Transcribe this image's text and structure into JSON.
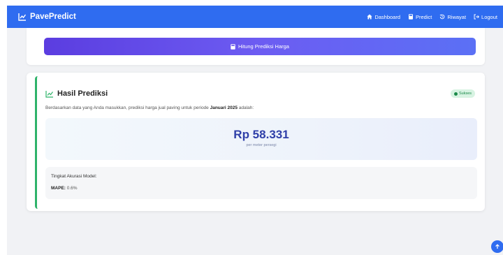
{
  "navbar": {
    "brand": "PavePredict",
    "items": [
      {
        "label": "Dashboard",
        "icon": "home-icon"
      },
      {
        "label": "Predict",
        "icon": "calculator-icon"
      },
      {
        "label": "Riwayat",
        "icon": "history-icon"
      },
      {
        "label": "Logout",
        "icon": "logout-icon"
      }
    ]
  },
  "form": {
    "calc_button_label": "Hitung Prediksi Harga"
  },
  "result": {
    "title": "Hasil Prediksi",
    "status_badge": "Sukses",
    "description_prefix": "Berdasarkan data yang Anda masukkan, prediksi harga jual paving untuk periode ",
    "period": "Januari 2025",
    "description_suffix": " adalah:",
    "price": "Rp 58.331",
    "price_unit": "per meter persegi",
    "accuracy_label": "Tingkat Akurasi Model:",
    "mape_label": "MAPE:",
    "mape_value": " 0.6%"
  },
  "colors": {
    "navbar": "#2f6cf0",
    "accent_green": "#2fb36a",
    "price_text": "#2f3fa8",
    "button_gradient_start": "#5b3de0",
    "button_gradient_end": "#5b70f5"
  }
}
